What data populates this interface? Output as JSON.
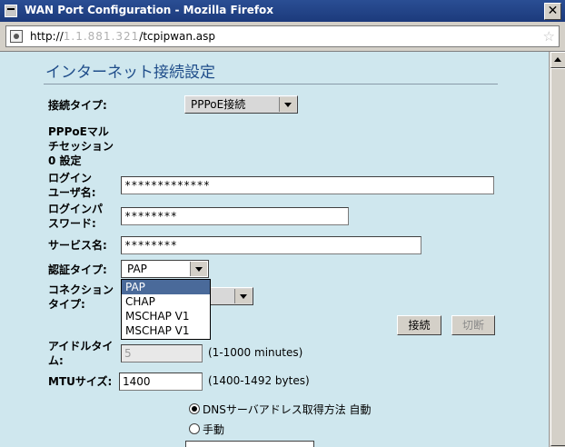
{
  "window": {
    "title": "WAN Port Configuration - Mozilla Firefox",
    "close_glyph": "✕"
  },
  "browser": {
    "url_prefix": "http://",
    "url_obscured": "1.1.881.321",
    "url_path": "/tcpipwan.asp",
    "star_glyph": "☆"
  },
  "page": {
    "heading": "インターネット接続設定",
    "connection_type": {
      "label": "接続タイプ:",
      "value": "PPPoE接続"
    },
    "multisession": {
      "label_lines": [
        "PPPoEマル",
        "チセッション",
        "0 設定"
      ]
    },
    "login_user": {
      "label_lines": [
        "ログイン",
        "ユーザ名:"
      ],
      "value": "*************"
    },
    "login_pass": {
      "label_lines": [
        "ログインパ",
        "スワード:"
      ],
      "value": "********"
    },
    "service_name": {
      "label": "サービス名:",
      "value": "********"
    },
    "auth_type": {
      "label": "認証タイプ:",
      "value": "PAP",
      "options": [
        "PAP",
        "CHAP",
        "MSCHAP V1",
        "MSCHAP V1"
      ],
      "selected_index": 0
    },
    "connection_mode": {
      "label_lines": [
        "コネクション",
        "タイプ:"
      ]
    },
    "buttons": {
      "connect": "接続",
      "disconnect": "切断"
    },
    "idle_time": {
      "label_lines": [
        "アイドルタイ",
        "ム:"
      ],
      "value": "5",
      "hint": "(1-1000 minutes)"
    },
    "mtu": {
      "label": "MTUサイズ:",
      "value": "1400",
      "hint": "(1400-1492 bytes)"
    },
    "dns": {
      "auto_label": "DNSサーバアドレス取得方法 自動",
      "manual_label": "手動",
      "selected": "auto"
    }
  }
}
